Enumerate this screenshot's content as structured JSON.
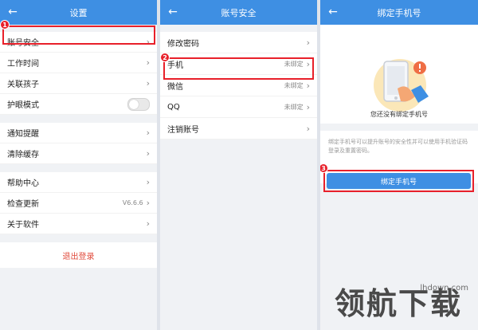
{
  "colors": {
    "primary": "#3e8fe3",
    "annotation_red": "#e8202a",
    "danger": "#e04a3b"
  },
  "panel1": {
    "title": "设置",
    "back_icon": "arrow-left-icon",
    "group1": [
      {
        "label": "账号安全"
      },
      {
        "label": "工作时间"
      },
      {
        "label": "关联孩子"
      },
      {
        "label": "护眼模式",
        "toggle": "off"
      }
    ],
    "group2": [
      {
        "label": "通知提醒"
      },
      {
        "label": "清除缓存"
      }
    ],
    "group3": [
      {
        "label": "帮助中心"
      },
      {
        "label": "检查更新",
        "value": "V6.6.6"
      },
      {
        "label": "关于软件"
      }
    ],
    "logout": "退出登录"
  },
  "panel2": {
    "title": "账号安全",
    "items": [
      {
        "label": "修改密码",
        "value": ""
      },
      {
        "label": "手机",
        "value": "未绑定"
      },
      {
        "label": "微信",
        "value": "未绑定"
      },
      {
        "label": "QQ",
        "value": "未绑定"
      },
      {
        "label": "注销账号",
        "value": ""
      }
    ]
  },
  "panel3": {
    "title": "绑定手机号",
    "not_bound_text": "您还没有绑定手机号",
    "description": "绑定手机号可以提升账号的安全性并可以使用手机验证码登录及重置密码。",
    "button": "绑定手机号"
  },
  "markers": [
    "1",
    "2",
    "3"
  ],
  "watermark": {
    "url": "lhdown.com",
    "brand": "领航下载"
  }
}
